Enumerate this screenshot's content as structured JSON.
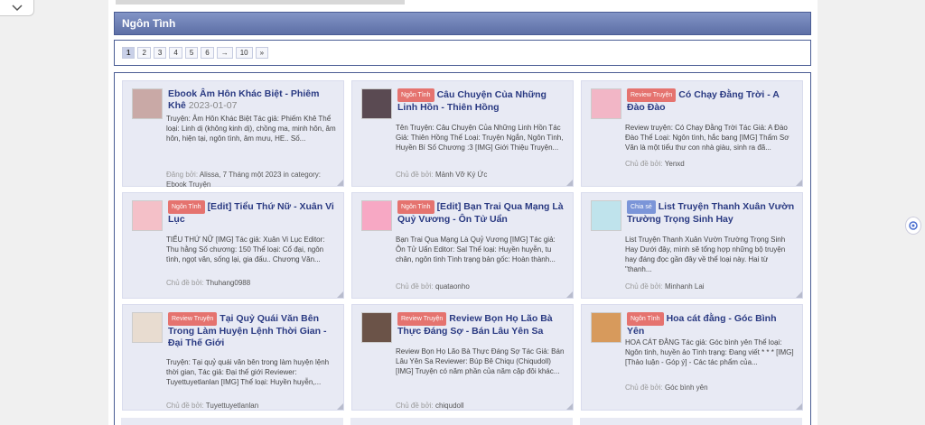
{
  "forum": {
    "title": "Ngôn Tình"
  },
  "pagination": {
    "pages": [
      "1",
      "2",
      "3",
      "4",
      "5",
      "6",
      "→",
      "10",
      "»"
    ],
    "active": "1"
  },
  "cards": [
    {
      "badge": "",
      "badge_color": "",
      "title": "Ebook Âm Hôn Khác Biệt - Phiêm Khê",
      "date": "2023-01-07",
      "excerpt": "Truyện: Âm Hôn Khác Biệt Tác giả: Phiếm Khê Thể loại: Linh dị (không kinh dị), chồng ma, minh hôn, âm hôn, hiện tại, ngôn tình, âm mưu, HE.. Số...",
      "author_label": "Đăng bởi:",
      "author": "Alissa, 7 Tháng một 2023 in category: Ebook Truyện",
      "thumb": "#c9a9a6"
    },
    {
      "badge": "Ngôn Tình",
      "badge_color": "red",
      "title": "Câu Chuyện Của Những Linh Hồn - Thiên Hồng",
      "date": "",
      "excerpt": "Tên Truyện: Câu Chuyện Của Những Linh Hồn Tác Giả: Thiên Hồng Thể Loại: Truyện Ngắn, Ngôn Tình, Huyền Bí Số Chương :3 [IMG] Giới Thiệu Truyện...",
      "author_label": "Chủ đề bởi:",
      "author": "Mảnh Vỡ Ký Ức",
      "thumb": "#5a4a52"
    },
    {
      "badge": "Review Truyện",
      "badge_color": "red",
      "title": "Có Chạy Đằng Trời - A Đào Đào",
      "date": "",
      "excerpt": "Review truyện: Có Chạy Đằng Trời Tác Giả: A Đào Đào Thể Loại: Ngôn tình, hắc bang [IMG] Thẩm Sơ Văn là một tiểu thư con nhà giàu, sinh ra đã...",
      "author_label": "Chủ đề bởi:",
      "author": "Yenxd",
      "thumb": "#f2b6c6"
    },
    {
      "badge": "Ngôn Tình",
      "badge_color": "red",
      "title": "[Edit] Tiểu Thứ Nữ - Xuân Vi Lục",
      "date": "",
      "excerpt": "TIỂU THỨ NỮ [IMG] Tác giả: Xuân Vi Lục Editor: Thu hằng Số chương: 150 Thể loại: Cổ đại, ngôn tình, ngọt văn, sống lại, gia đấu.. Chương Văn...",
      "author_label": "Chủ đề bởi:",
      "author": "Thuhang0988",
      "thumb": "#f4c0c8"
    },
    {
      "badge": "Ngôn Tình",
      "badge_color": "red",
      "title": "[Edit] Bạn Trai Qua Mạng Là Quỷ Vương - Ôn Tử Uẩn",
      "date": "",
      "excerpt": "Bạn Trai Qua Mạng Là Quỷ Vương [IMG] Tác giả: Ôn Tử Uẩn Editor: Sal Thể loại: Huyền huyễn, tu chân, ngôn tình Tình trạng bản gốc: Hoàn thành...",
      "author_label": "Chủ đề bởi:",
      "author": "quataonho",
      "thumb": "#f7a8c4"
    },
    {
      "badge": "Chia sẻ",
      "badge_color": "blue",
      "title": "List Truyện Thanh Xuân Vườn Trường Trọng Sinh Hay",
      "date": "",
      "excerpt": "List Truyện Thanh Xuân Vườn Trường Trọng Sinh Hay Dưới đây, mình sẽ tổng hợp những bộ truyện hay đáng đọc gần đây về thể loại này. Hai từ \"thanh...",
      "author_label": "Chủ đề bởi:",
      "author": "Minhanh Lai",
      "thumb": "#bfe3ec"
    },
    {
      "badge": "Review Truyện",
      "badge_color": "red",
      "title": "Tại Quỷ Quái Văn Bên Trong Làm Huyện Lệnh Thời Gian - Đại Thế Giới",
      "date": "",
      "excerpt": "Truyện: Tại quỷ quái văn bên trong làm huyện lệnh thời gian, Tác giả: Đại thế giới Reviewer: Tuyettuyetlanlan [IMG] Thể loại: Huyền huyễn,...",
      "author_label": "Chủ đề bởi:",
      "author": "Tuyettuyetlanlan",
      "thumb": "#e8dcd0"
    },
    {
      "badge": "Review Truyện",
      "badge_color": "red",
      "title": "Review Bọn Họ Lão Bà Thực Đáng Sợ - Bán Lâu Yên Sa",
      "date": "",
      "excerpt": "Review Bọn Họ Lão Bà Thực Đáng Sợ Tác Giả: Bán Lâu Yên Sa Reviewer: Búp Bê Chiqu (Chiqudoll) [IMG] Truyện có năm phần của năm cặp đôi khác...",
      "author_label": "Chủ đề bởi:",
      "author": "chiqudoll",
      "thumb": "#6b5348"
    },
    {
      "badge": "Ngôn Tình",
      "badge_color": "red",
      "title": "Hoa cát đằng - Góc Bình Yên",
      "date": "",
      "excerpt": "HOA CÁT ĐẰNG Tác giả: Góc bình yên Thể loại: Ngôn tình, huyền ảo Tình trạng: Đang viết * * * [IMG] [Thảo luận - Góp ý] - Các tác phẩm của...",
      "author_label": "Chủ đề bởi:",
      "author": "Góc bình yên",
      "thumb": "#d79a5c"
    }
  ]
}
